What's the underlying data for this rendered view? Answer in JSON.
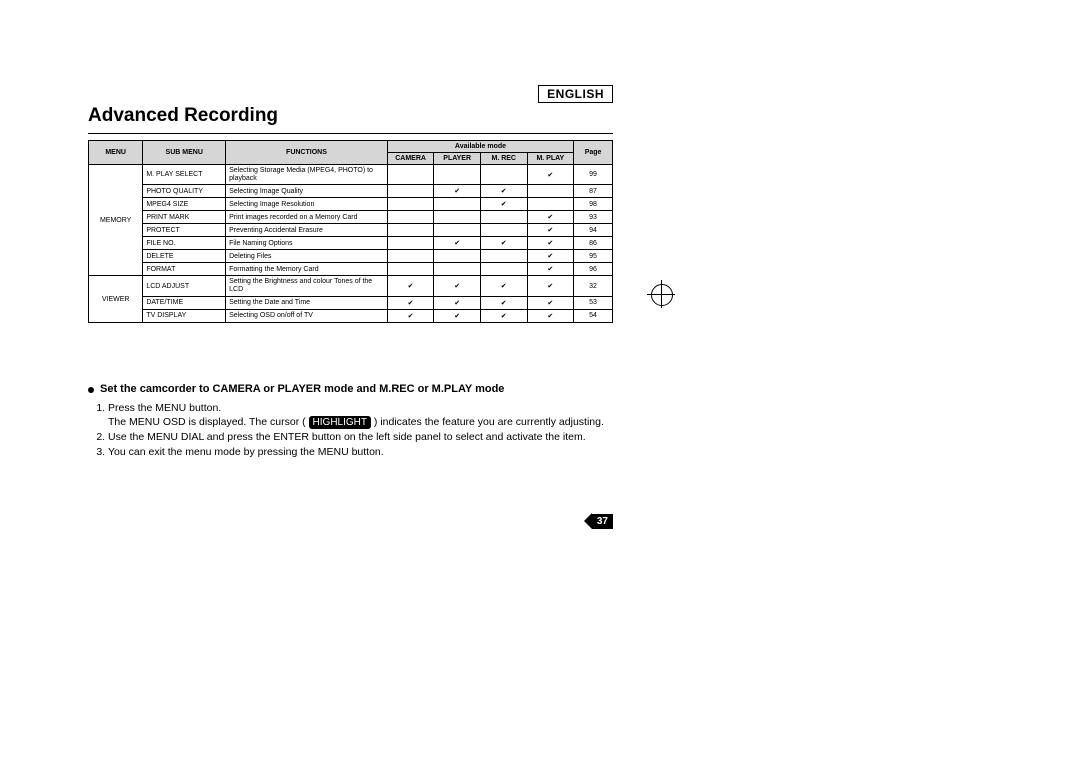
{
  "language": "ENGLISH",
  "section_title": "Advanced Recording",
  "table": {
    "headers": {
      "menu": "MENU",
      "sub_menu": "SUB MENU",
      "functions": "FUNCTIONS",
      "available_mode": "Available mode",
      "camera": "CAMERA",
      "player": "PLAYER",
      "mrec": "M. REC",
      "mplay": "M. PLAY",
      "page": "Page"
    },
    "groups": [
      {
        "menu": "MEMORY",
        "rows": [
          {
            "sub": "M. PLAY SELECT",
            "func": "Selecting Storage Media (MPEG4, PHOTO) to playback",
            "camera": "",
            "player": "",
            "mrec": "",
            "mplay": "✔",
            "page": "99"
          },
          {
            "sub": "PHOTO QUALITY",
            "func": "Selecting Image Quality",
            "camera": "",
            "player": "✔",
            "mrec": "✔",
            "mplay": "",
            "page": "87"
          },
          {
            "sub": "MPEG4 SIZE",
            "func": "Selecting Image Resolution",
            "camera": "",
            "player": "",
            "mrec": "✔",
            "mplay": "",
            "page": "98"
          },
          {
            "sub": "PRINT MARK",
            "func": "Print images recorded on a Memory Card",
            "camera": "",
            "player": "",
            "mrec": "",
            "mplay": "✔",
            "page": "93"
          },
          {
            "sub": "PROTECT",
            "func": "Preventing Accidental Erasure",
            "camera": "",
            "player": "",
            "mrec": "",
            "mplay": "✔",
            "page": "94"
          },
          {
            "sub": "FILE NO.",
            "func": "File Naming Options",
            "camera": "",
            "player": "✔",
            "mrec": "✔",
            "mplay": "✔",
            "page": "86"
          },
          {
            "sub": "DELETE",
            "func": "Deleting Files",
            "camera": "",
            "player": "",
            "mrec": "",
            "mplay": "✔",
            "page": "95"
          },
          {
            "sub": "FORMAT",
            "func": "Formatting the Memory Card",
            "camera": "",
            "player": "",
            "mrec": "",
            "mplay": "✔",
            "page": "96"
          }
        ]
      },
      {
        "menu": "VIEWER",
        "rows": [
          {
            "sub": "LCD ADJUST",
            "func": "Setting the Brightness and colour Tones of the LCD",
            "camera": "✔",
            "player": "✔",
            "mrec": "✔",
            "mplay": "✔",
            "page": "32"
          },
          {
            "sub": "DATE/TIME",
            "func": "Setting the Date and Time",
            "camera": "✔",
            "player": "✔",
            "mrec": "✔",
            "mplay": "✔",
            "page": "53"
          },
          {
            "sub": "TV DISPLAY",
            "func": "Selecting OSD on/off of TV",
            "camera": "✔",
            "player": "✔",
            "mrec": "✔",
            "mplay": "✔",
            "page": "54"
          }
        ]
      }
    ]
  },
  "instruction_heading": "Set the camcorder to CAMERA or PLAYER mode and M.REC or M.PLAY mode",
  "steps": {
    "s1": "Press the MENU button.",
    "s1b_a": "The MENU OSD is displayed. The cursor ( ",
    "highlight": "HIGHLIGHT",
    "s1b_b": " ) indicates the feature you are currently adjusting.",
    "s2": "Use the MENU DIAL and press the ENTER button on the left side panel to select and activate the item.",
    "s3": "You can exit the menu mode by pressing the MENU button."
  },
  "page_number": "37"
}
